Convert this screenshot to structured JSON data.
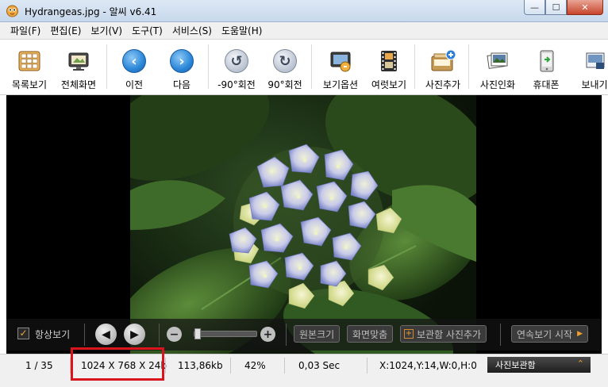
{
  "window": {
    "title": "Hydrangeas.jpg - 알씨 v6.41",
    "minimize_glyph": "—",
    "maximize_glyph": "☐",
    "close_glyph": "✕"
  },
  "menu": [
    "파일(F)",
    "편집(E)",
    "보기(V)",
    "도구(T)",
    "서비스(S)",
    "도움말(H)"
  ],
  "toolbar": {
    "list_view": "목록보기",
    "fullscreen": "전체화면",
    "prev": "이전",
    "next": "다음",
    "rotate_left": "-90°회전",
    "rotate_right": "90°회전",
    "view_options": "보기옵션",
    "multi_view": "여럿보기",
    "add_photo": "사진추가",
    "print_photo": "사진인화",
    "phone": "휴대폰",
    "send": "보내기"
  },
  "controls": {
    "always_view": "항상보기",
    "original_size": "원본크기",
    "fit_screen": "화면맞춤",
    "add_to_album": "보관함 사진추가",
    "slideshow_start": "연속보기 시작",
    "always_view_checked": true
  },
  "status": {
    "index": "1 / 35",
    "dimensions": "1024 X 768 X 24b",
    "file_size": "113,86kb",
    "zoom": "42%",
    "load_time": "0,03 Sec",
    "cursor_info": "X:1024,Y:14,W:0,H:0",
    "album_tab": "사진보관함"
  },
  "image": {
    "file": "Hydrangeas.jpg"
  }
}
